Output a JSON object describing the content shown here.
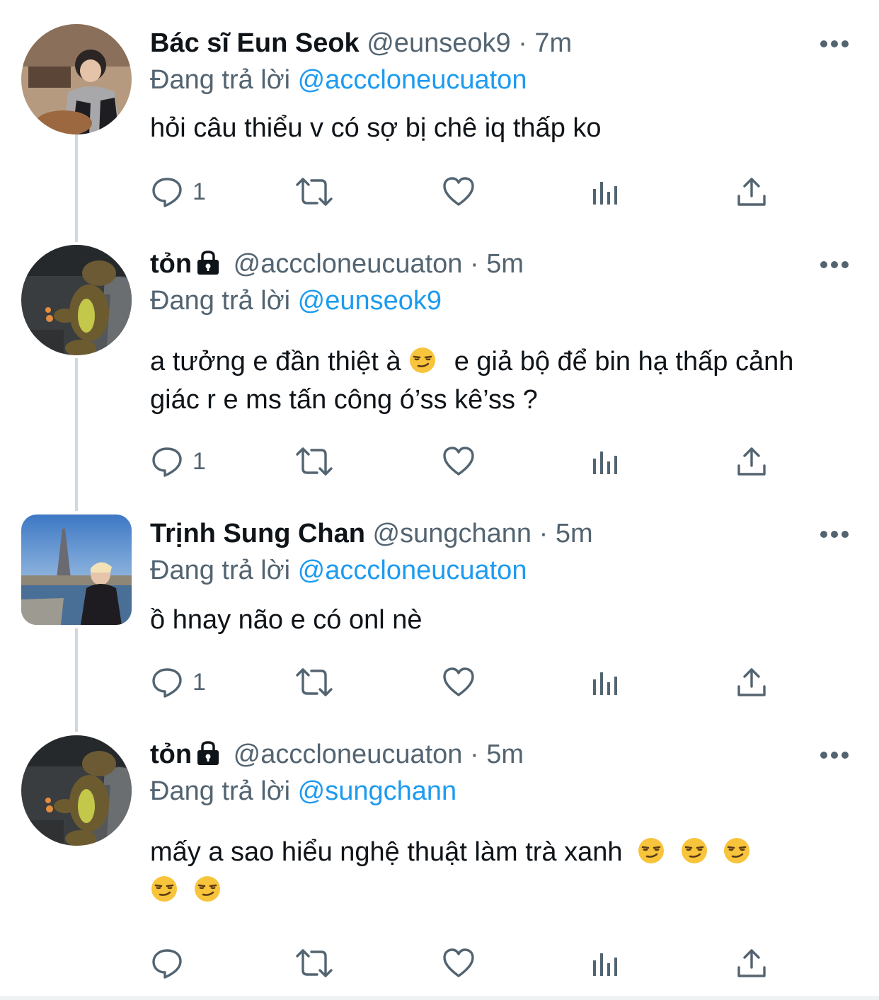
{
  "tweets": [
    {
      "name": "Bác sĩ Eun Seok",
      "handle": "@eunseok9",
      "separator": "·",
      "time": "7m",
      "locked": false,
      "replying_prefix": "Đang trả lời",
      "replying_to": "@acccloneucuaton",
      "text_before": "hỏi câu thiểu v có sợ bị chê iq thấp ko",
      "reply_count": "1"
    },
    {
      "name": "tỏn",
      "handle": "@acccloneucuaton",
      "separator": "·",
      "time": "5m",
      "locked": true,
      "replying_prefix": "Đang trả lời",
      "replying_to": "@eunseok9",
      "text_before": "a tưởng e đần thiệt à",
      "text_after": "e giả bộ để bin hạ thấp cảnh giác r e ms tấn công ó’ss kê’ss ?",
      "reply_count": "1"
    },
    {
      "name": "Trịnh Sung Chan",
      "handle": "@sungchann",
      "separator": "·",
      "time": "5m",
      "locked": false,
      "replying_prefix": "Đang trả lời",
      "replying_to": "@acccloneucuaton",
      "text_before": "ồ hnay não e có onl nè",
      "reply_count": "1"
    },
    {
      "name": "tỏn",
      "handle": "@acccloneucuaton",
      "separator": "·",
      "time": "5m",
      "locked": true,
      "replying_prefix": "Đang trả lời",
      "replying_to": "@sungchann",
      "text_before": "mấy a sao hiểu nghệ thuật làm trà xanh",
      "reply_count": ""
    }
  ],
  "icons": {
    "reply": "comment-icon",
    "retweet": "retweet-icon",
    "like": "heart-icon",
    "views": "analytics-icon",
    "share": "share-icon",
    "more": "more-dots-icon",
    "lock": "lock-icon",
    "emoji": "smirking-face-emoji"
  },
  "colors": {
    "link": "#1d9bf0",
    "secondary": "#536471",
    "thread_line": "#cfd9de"
  }
}
